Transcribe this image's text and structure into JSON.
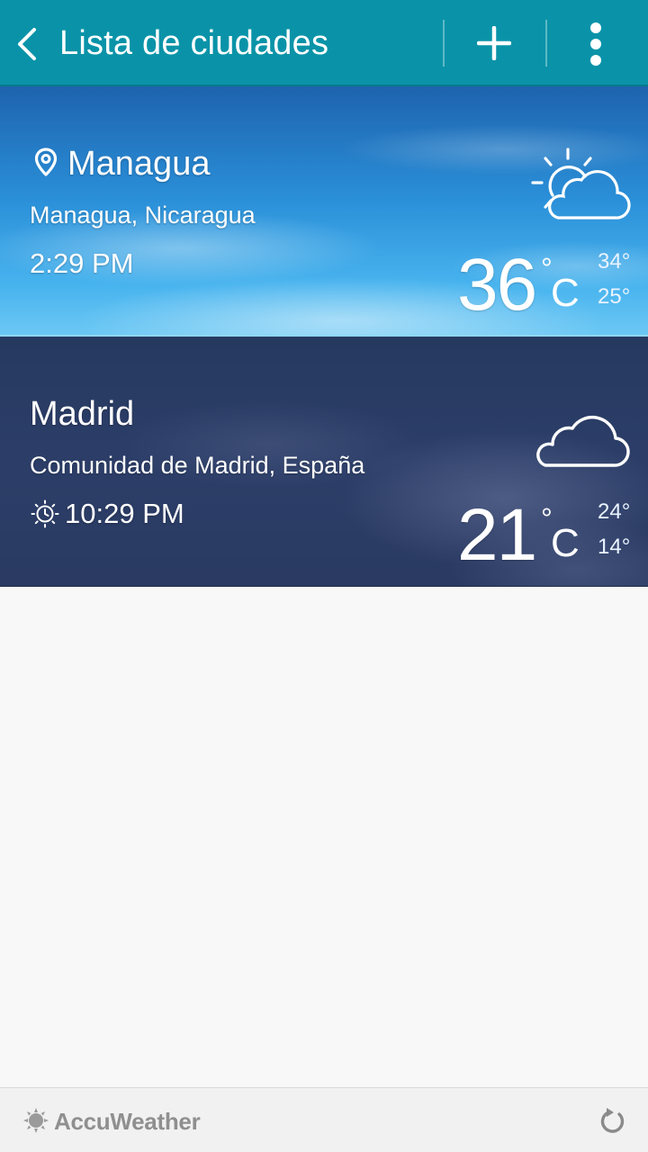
{
  "header": {
    "title": "Lista de ciudades",
    "background_color": "#0a93a8"
  },
  "cities": [
    {
      "name": "Managua",
      "region": "Managua, Nicaragua",
      "time": "2:29 PM",
      "temp": "36",
      "unit": "C",
      "high": "34°",
      "low": "25°",
      "condition_icon": "sun-cloud-icon",
      "is_current_location": true,
      "is_night": false
    },
    {
      "name": "Madrid",
      "region": "Comunidad de Madrid, España",
      "time": "10:29 PM",
      "temp": "21",
      "unit": "C",
      "high": "24°",
      "low": "14°",
      "condition_icon": "cloud-icon",
      "is_current_location": false,
      "is_night": true
    }
  ],
  "footer": {
    "brand": "AccuWeather"
  }
}
